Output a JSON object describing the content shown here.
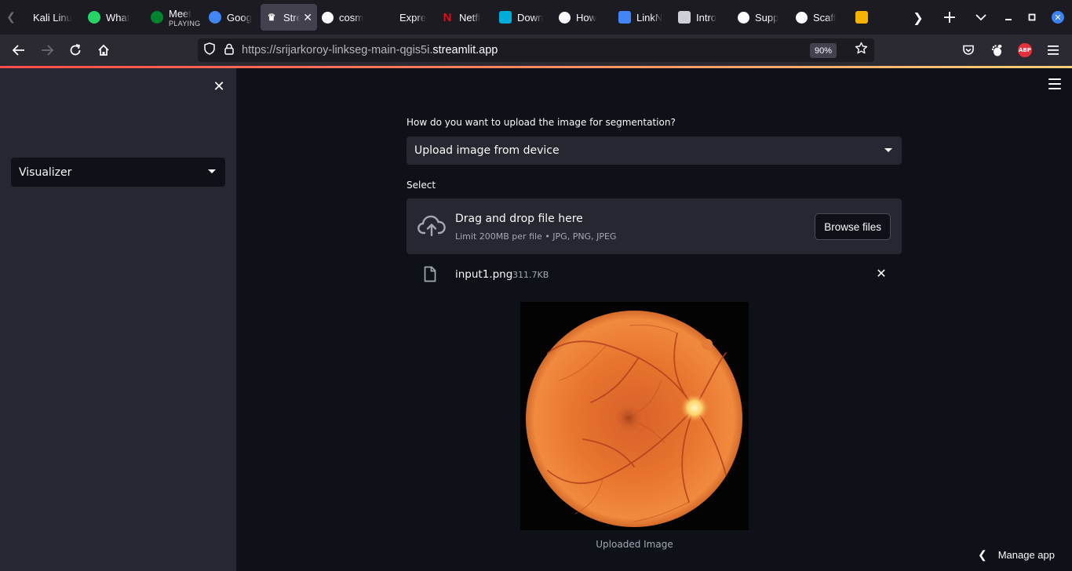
{
  "browser": {
    "tabs": [
      {
        "label": "Kali Linu",
        "icon": "kali-icon",
        "color": "#1c1b22"
      },
      {
        "label": "What",
        "icon": "whatsapp-icon",
        "color": "#25d366"
      },
      {
        "label": "Meet",
        "sub": "PLAYING",
        "icon": "meet-icon",
        "color": "#00832d"
      },
      {
        "label": "Goog",
        "icon": "google-icon",
        "color": "#4285f4"
      },
      {
        "label": "Stre",
        "icon": "streamlit-icon",
        "color": "#42414d",
        "active": true
      },
      {
        "label": "cosm",
        "icon": "github-icon",
        "color": "#1c1b22"
      },
      {
        "label": "Expre",
        "icon": "express-icon",
        "color": "#1c1b22"
      },
      {
        "label": "Netfl",
        "icon": "netflix-icon",
        "color": "#e50914"
      },
      {
        "label": "Down",
        "icon": "golang-icon",
        "color": "#00add8"
      },
      {
        "label": "How",
        "icon": "github-icon",
        "color": "#1c1b22"
      },
      {
        "label": "LinkN",
        "icon": "docs-icon",
        "color": "#4285f4"
      },
      {
        "label": "Intro",
        "icon": "gc-icon",
        "color": "#cfcfd8"
      },
      {
        "label": "Supp",
        "icon": "github-icon",
        "color": "#1c1b22"
      },
      {
        "label": "Scaff",
        "icon": "github-icon",
        "color": "#1c1b22"
      },
      {
        "label": "(",
        "icon": "slides-icon",
        "color": "#f4b400"
      }
    ],
    "url_prefix": "https://srijarkoroy-linkseg-main-qgis5i.",
    "url_domain": "streamlit.app",
    "zoom": "90%",
    "abp_label": "ABP"
  },
  "sidebar": {
    "select_value": "Visualizer"
  },
  "main": {
    "upload_question": "How do you want to upload the image for segmentation?",
    "upload_method": "Upload image from device",
    "select_label": "Select",
    "dropzone_title": "Drag and drop file here",
    "dropzone_limit": "Limit 200MB per file • JPG, PNG, JPEG",
    "browse_label": "Browse files",
    "file_name": "input1.png",
    "file_size": "311.7KB",
    "image_caption": "Uploaded Image",
    "manage_label": "Manage app"
  },
  "colors": {
    "app_bg": "#0e1117",
    "sidebar_bg": "#262730",
    "widget_bg": "#262730",
    "accent": "#ff4b4b",
    "retina": "#e8742e"
  }
}
